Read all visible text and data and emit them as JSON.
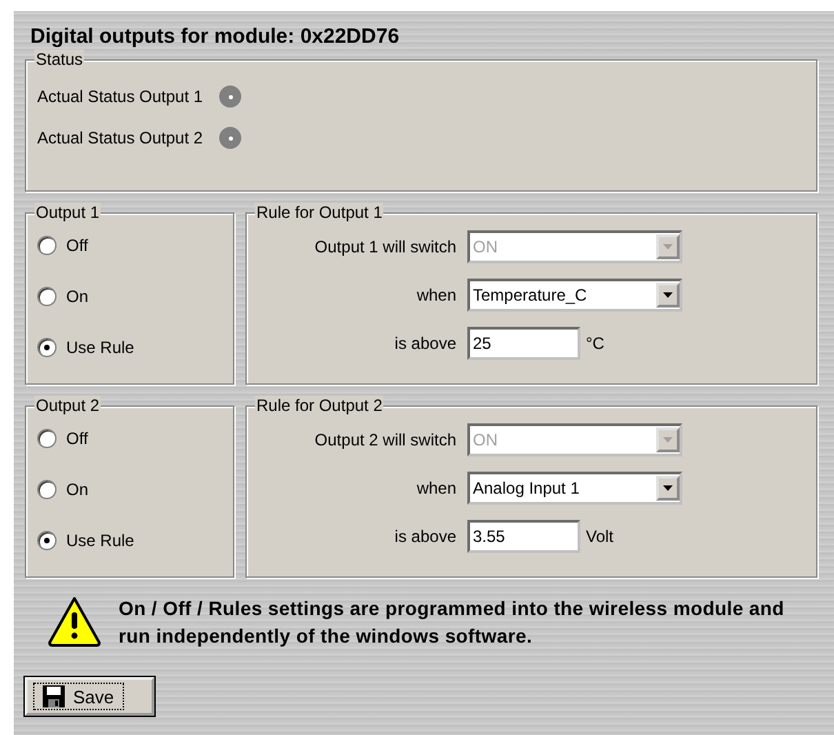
{
  "title": "Digital outputs for module: 0x22DD76",
  "status": {
    "legend": "Status",
    "items": [
      {
        "label": "Actual Status Output 1",
        "on": false
      },
      {
        "label": "Actual Status Output 2",
        "on": false
      }
    ]
  },
  "outputs": [
    {
      "legend": "Output 1",
      "options": [
        {
          "label": "Off",
          "selected": false
        },
        {
          "label": "On",
          "selected": false
        },
        {
          "label": "Use Rule",
          "selected": true
        }
      ],
      "rule": {
        "legend": "Rule for Output 1",
        "switch_label": "Output 1 will switch",
        "switch_value": "ON",
        "switch_disabled": true,
        "when_label": "when",
        "when_value": "Temperature_C",
        "above_label": "is above",
        "above_value": "25",
        "unit": "°C"
      }
    },
    {
      "legend": "Output 2",
      "options": [
        {
          "label": "Off",
          "selected": false
        },
        {
          "label": "On",
          "selected": false
        },
        {
          "label": "Use Rule",
          "selected": true
        }
      ],
      "rule": {
        "legend": "Rule for Output 2",
        "switch_label": "Output 2 will switch",
        "switch_value": "ON",
        "switch_disabled": true,
        "when_label": "when",
        "when_value": "Analog Input 1",
        "above_label": "is above",
        "above_value": "3.55",
        "unit": "Volt"
      }
    }
  ],
  "warning": "On / Off / Rules settings are programmed into the wireless module and run independently of the windows software.",
  "save_button": "Save"
}
